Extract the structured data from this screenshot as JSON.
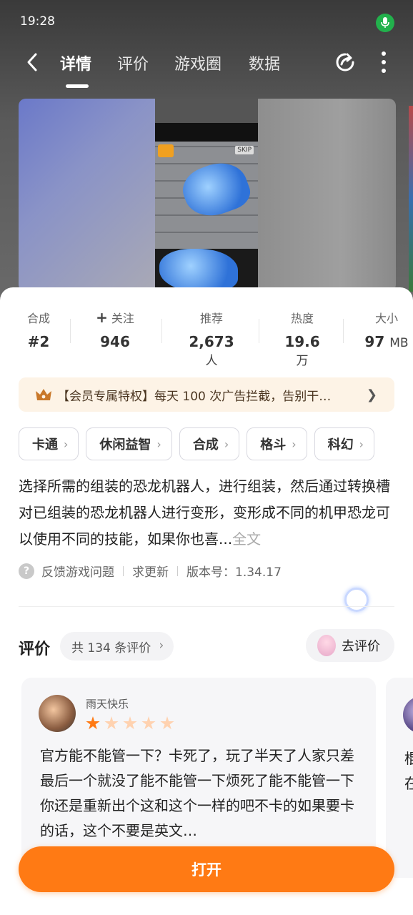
{
  "status_bar": {
    "time": "19:28"
  },
  "nav": {
    "tabs": [
      {
        "label": "详情",
        "active": true
      },
      {
        "label": "评价",
        "active": false
      },
      {
        "label": "游戏圈",
        "active": false
      },
      {
        "label": "数据",
        "active": false
      }
    ]
  },
  "stats": [
    {
      "label": "合成",
      "value": "#2",
      "unit": ""
    },
    {
      "label": "关注",
      "value": "946",
      "unit": "",
      "prefix_icon": "plus-icon"
    },
    {
      "label": "推荐",
      "value": "2,673",
      "unit": "人"
    },
    {
      "label": "热度",
      "value": "19.6",
      "unit": "万"
    },
    {
      "label": "大小",
      "value": "97",
      "unit": "MB"
    }
  ],
  "vip": {
    "text": "【会员专属特权】每天 100 次广告拦截，告别干…"
  },
  "tags": [
    "卡通",
    "休闲益智",
    "合成",
    "格斗",
    "科幻"
  ],
  "description": {
    "text": "选择所需的组装的恐龙机器人，进行组装，然后通过转换槽对已组装的恐龙机器人进行变形，变形成不同的机甲恐龙可以使用不同的技能，如果你也喜...",
    "more": "全文"
  },
  "meta": {
    "feedback": "反馈游戏问题",
    "update": "求更新",
    "version": "版本号：1.34.17"
  },
  "reviews": {
    "title": "评价",
    "count": "共 134 条评价",
    "go_review": "去评价",
    "items": [
      {
        "username": "雨天快乐",
        "rating": 1,
        "max_rating": 5,
        "text": "官方能不能管一下？卡死了，玩了半天了人家只差最后一个就没了能不能管一下烦死了能不能管一下你还是重新出个这和这个一样的吧不卡的如果要卡的话，这个不要是英文…"
      },
      {
        "text": "棍\n在"
      }
    ]
  },
  "open_button": {
    "label": "打开"
  },
  "colors": {
    "accent": "#ff7a14",
    "star_on": "#ff7a14",
    "star_off": "#ffd2b0"
  }
}
